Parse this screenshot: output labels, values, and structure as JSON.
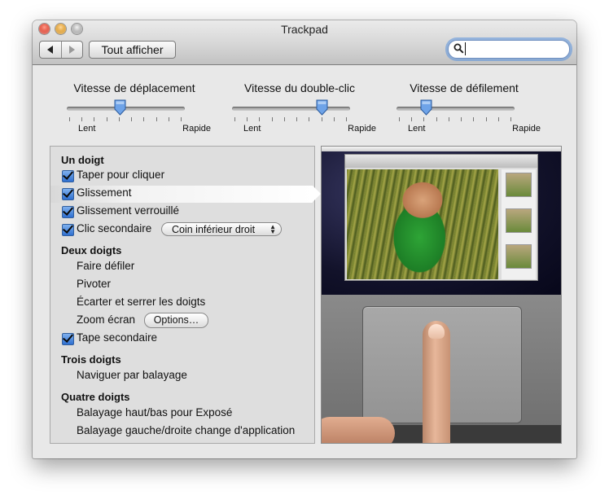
{
  "window": {
    "title": "Trackpad",
    "back_icon": "back-arrow-icon",
    "forward_icon": "forward-arrow-icon",
    "show_all_label": "Tout afficher",
    "search": {
      "placeholder": "",
      "value": "",
      "icon": "magnifier-icon"
    }
  },
  "sliders": [
    {
      "title": "Vitesse de déplacement",
      "min_label": "Lent",
      "max_label": "Rapide",
      "value_fraction": 0.45,
      "tick_count": 10
    },
    {
      "title": "Vitesse du double-clic",
      "min_label": "Lent",
      "max_label": "Rapide",
      "value_fraction": 0.76,
      "tick_count": 10
    },
    {
      "title": "Vitesse de défilement",
      "min_label": "Lent",
      "max_label": "Rapide",
      "value_fraction": 0.25,
      "tick_count": 10
    }
  ],
  "sections": {
    "one_finger": {
      "title": "Un doigt",
      "tap_to_click": {
        "label": "Taper pour cliquer",
        "checked": true
      },
      "dragging": {
        "label": "Glissement",
        "checked": true,
        "selected": true
      },
      "drag_lock": {
        "label": "Glissement verrouillé",
        "checked": true
      },
      "secondary_click": {
        "label": "Clic secondaire",
        "checked": true,
        "popup_value": "Coin inférieur droit"
      }
    },
    "two_fingers": {
      "title": "Deux doigts",
      "scroll": "Faire défiler",
      "rotate": "Pivoter",
      "pinch": "Écarter et serrer les doigts",
      "screen_zoom": "Zoom écran",
      "options_button": "Options…",
      "secondary_tap": {
        "label": "Tape secondaire",
        "checked": true
      }
    },
    "three_fingers": {
      "title": "Trois doigts",
      "swipe": "Naviguer par balayage"
    },
    "four_fingers": {
      "title": "Quatre doigts",
      "expose": "Balayage haut/bas pour Exposé",
      "app_switch": "Balayage gauche/droite change d'application"
    }
  },
  "colors": {
    "accent": "#3a7bd5",
    "panel": "#dedede",
    "window": "#e8e8e8"
  }
}
